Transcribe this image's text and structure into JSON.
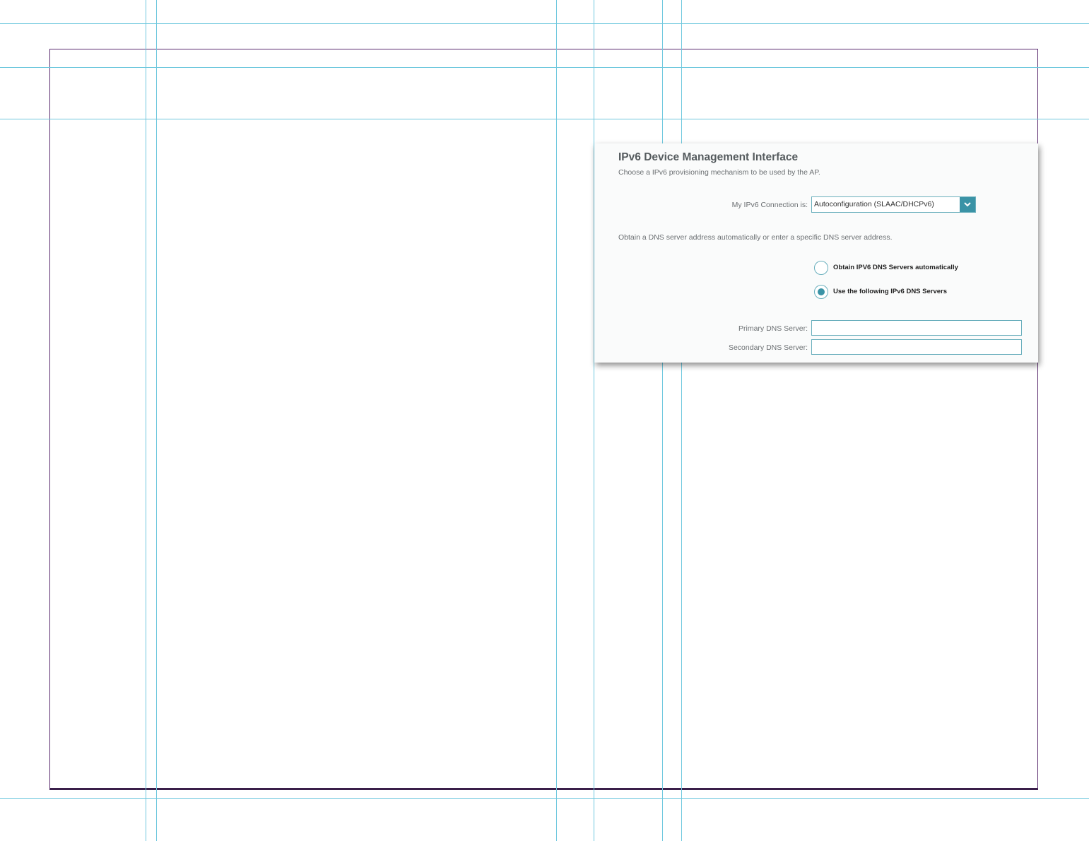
{
  "panel": {
    "title": "IPv6 Device Management Interface",
    "subtitle": "Choose a IPv6 provisioning mechanism to be used by the AP.",
    "connection": {
      "label": "My IPv6 Connection is:",
      "selected_value": "Autoconfiguration (SLAAC/DHCPv6)",
      "dropdown_icon": "chevron-down-icon"
    },
    "dns_description": "Obtain a DNS server address automatically or enter a specific DNS server address.",
    "dns_options": [
      {
        "label": "Obtain IPV6 DNS Servers automatically",
        "selected": false
      },
      {
        "label": "Use the following IPv6 DNS Servers",
        "selected": true
      }
    ],
    "primary_dns": {
      "label": "Primary DNS Server:",
      "value": ""
    },
    "secondary_dns": {
      "label": "Secondary DNS Server:",
      "value": ""
    }
  },
  "colors": {
    "accent": "#3a93a6",
    "field_border": "#6aafbd",
    "guide": "#6fc8de",
    "frame": "#5a2a6e"
  }
}
